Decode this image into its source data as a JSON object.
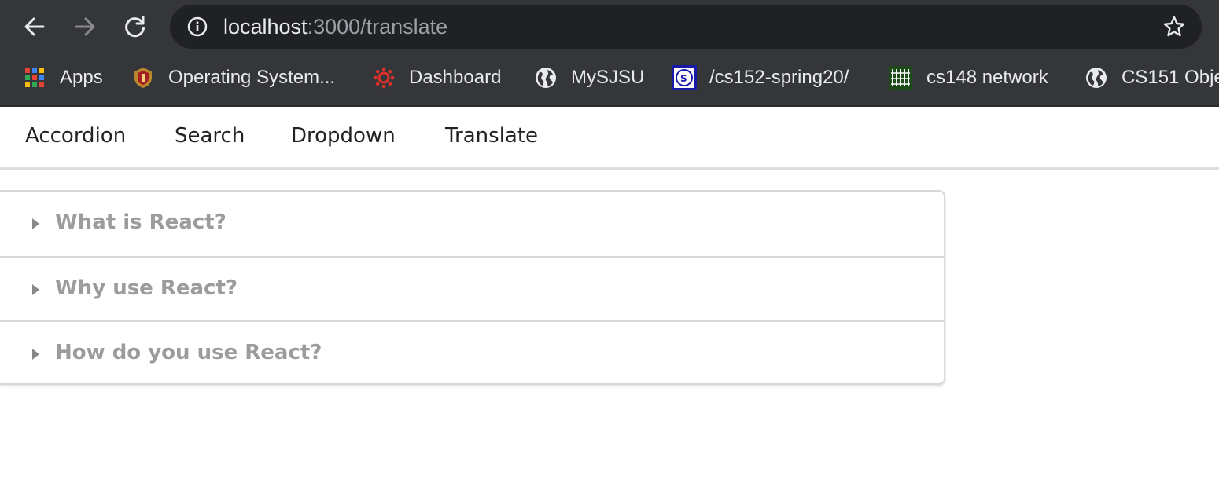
{
  "browser": {
    "url_host": "localhost",
    "url_path": ":3000/translate",
    "bookmarks": [
      {
        "label": "Apps",
        "icon": "apps-grid-icon"
      },
      {
        "label": "Operating System...",
        "icon": "university-seal-icon"
      },
      {
        "label": "Dashboard",
        "icon": "canvas-icon"
      },
      {
        "label": "MySJSU",
        "icon": "globe-icon"
      },
      {
        "label": "/cs152-spring20/",
        "icon": "cs-logo-icon"
      },
      {
        "label": "cs148 network",
        "icon": "network-icon"
      },
      {
        "label": "CS151 Obje",
        "icon": "globe-icon"
      }
    ]
  },
  "menu": {
    "items": [
      "Accordion",
      "Search",
      "Dropdown",
      "Translate"
    ]
  },
  "accordion": {
    "items": [
      {
        "title": "What is React?"
      },
      {
        "title": "Why use React?"
      },
      {
        "title": "How do you use React?"
      }
    ]
  },
  "colors": {
    "chrome_bg": "#35363a",
    "omnibox_bg": "#202124",
    "accordion_title": "#9c9c9c"
  }
}
